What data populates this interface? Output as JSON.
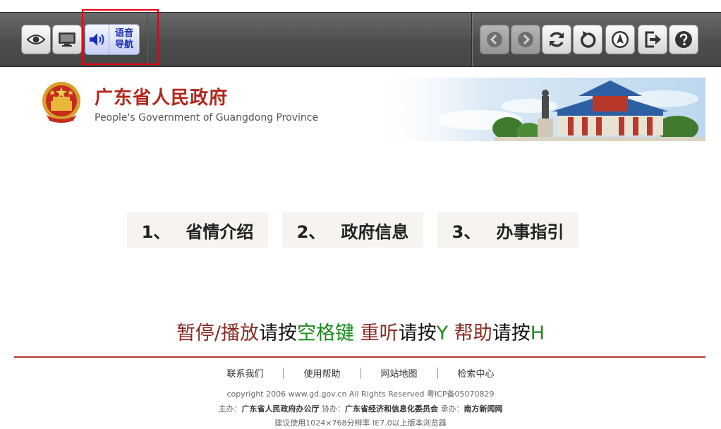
{
  "toolbar": {
    "left_buttons": [
      {
        "name": "eye-icon",
        "label": ""
      },
      {
        "name": "monitor-icon",
        "label": ""
      }
    ],
    "voice_nav": {
      "label_line1": "语音",
      "label_line2": "导航"
    },
    "right_buttons": [
      {
        "name": "back-icon"
      },
      {
        "name": "forward-icon"
      },
      {
        "name": "refresh-icon"
      },
      {
        "name": "undo-icon"
      },
      {
        "name": "compass-icon"
      },
      {
        "name": "exit-icon"
      },
      {
        "name": "help-icon"
      }
    ],
    "colors": {
      "highlight": "#e60012",
      "voice_text": "#1a2fb3"
    }
  },
  "header": {
    "title": "广东省人民政府",
    "subtitle": "People's Government of Guangdong Province",
    "title_color": "#b2271b"
  },
  "menu": {
    "items": [
      {
        "num": "1、",
        "label": "省情介绍"
      },
      {
        "num": "2、",
        "label": "政府信息"
      },
      {
        "num": "3、",
        "label": "办事指引"
      }
    ]
  },
  "hint": {
    "pause_play": "暂停/播放",
    "press1": "请按",
    "space_key": "空格键",
    "replay": "重听",
    "press2": "请按",
    "y_key": "Y",
    "help": "帮助",
    "press3": "请按",
    "h_key": "H"
  },
  "footer": {
    "links": [
      "联系我们",
      "使用帮助",
      "网站地图",
      "检索中心"
    ],
    "copyright": "copyright 2006 www.gd.gov.cn All Rights Reserved 粤ICP备05070829",
    "host_label": "主办：",
    "host": "广东省人民政府办公厅",
    "co_label": "协办：",
    "co": "广东省经济和信息化委员会",
    "undertake_label": "承办：",
    "undertake": "南方新闻网",
    "browser_note": "建议使用1024×768分辨率 IE7.0以上版本浏览器"
  }
}
